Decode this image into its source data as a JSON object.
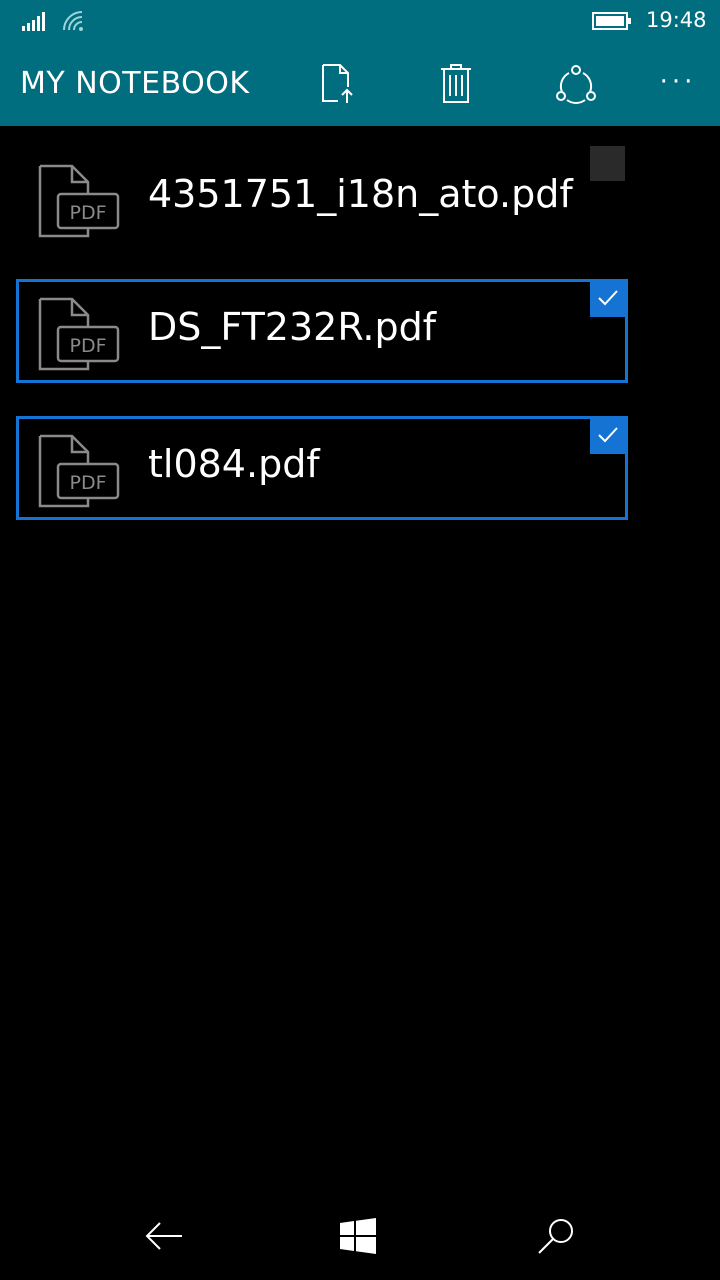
{
  "status_bar": {
    "time": "19:48",
    "signal_icon": "cellular-signal-icon",
    "wifi_icon": "wifi-icon",
    "battery_icon": "battery-icon"
  },
  "app_bar": {
    "title": "MY NOTEBOOK",
    "actions": [
      {
        "icon": "file-upload-icon"
      },
      {
        "icon": "trash-icon"
      },
      {
        "icon": "share-icon"
      },
      {
        "icon": "more-icon",
        "label": "···"
      }
    ]
  },
  "files": [
    {
      "name": "4351751_i18n_ato.pdf",
      "icon_label": "PDF",
      "selected": false
    },
    {
      "name": "DS_FT232R.pdf",
      "icon_label": "PDF",
      "selected": true
    },
    {
      "name": "tl084.pdf",
      "icon_label": "PDF",
      "selected": true
    }
  ],
  "nav_bar": {
    "back_icon": "back-arrow-icon",
    "home_icon": "windows-logo-icon",
    "search_icon": "search-icon"
  },
  "colors": {
    "header": "#006e7f",
    "accent": "#1473d3",
    "background": "#000000",
    "unchecked_box": "#2a2a2a"
  }
}
